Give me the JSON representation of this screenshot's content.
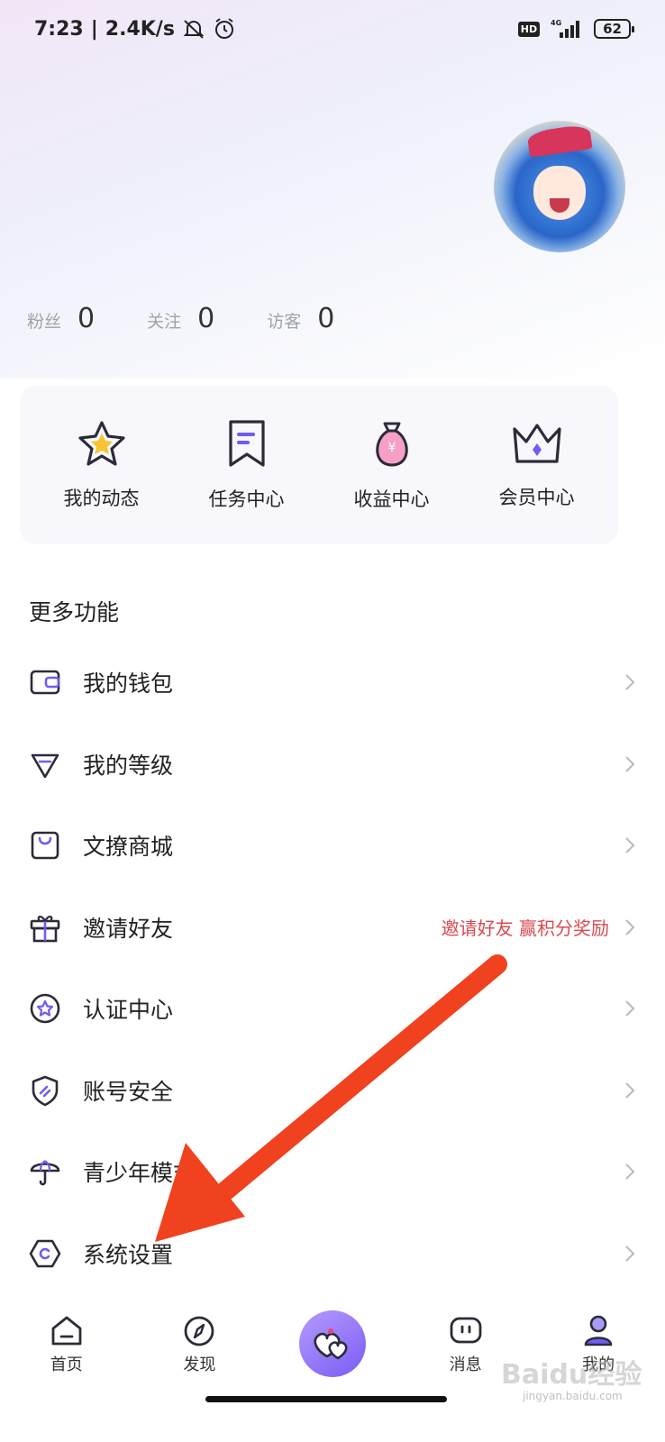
{
  "status_bar": {
    "time": "7:23",
    "speed": "2.4K/s",
    "network": "4G",
    "battery": "62"
  },
  "stats": [
    {
      "label": "粉丝",
      "value": "0"
    },
    {
      "label": "关注",
      "value": "0"
    },
    {
      "label": "访客",
      "value": "0"
    }
  ],
  "quick_actions": [
    {
      "label": "我的动态",
      "icon": "star-icon"
    },
    {
      "label": "任务中心",
      "icon": "bookmark-icon"
    },
    {
      "label": "收益中心",
      "icon": "money-bag-icon"
    },
    {
      "label": "会员中心",
      "icon": "crown-icon"
    }
  ],
  "section_title": "更多功能",
  "menu": [
    {
      "label": "我的钱包",
      "icon": "wallet-icon",
      "extra": ""
    },
    {
      "label": "我的等级",
      "icon": "diamond-icon",
      "extra": ""
    },
    {
      "label": "文撩商城",
      "icon": "shopping-bag-icon",
      "extra": ""
    },
    {
      "label": "邀请好友",
      "icon": "gift-icon",
      "extra": "邀请好友 赢积分奖励"
    },
    {
      "label": "认证中心",
      "icon": "badge-star-icon",
      "extra": ""
    },
    {
      "label": "账号安全",
      "icon": "shield-icon",
      "extra": ""
    },
    {
      "label": "青少年模式",
      "icon": "umbrella-icon",
      "extra": ""
    },
    {
      "label": "系统设置",
      "icon": "hexagon-settings-icon",
      "extra": ""
    }
  ],
  "tabs": [
    {
      "label": "首页",
      "icon": "home-icon"
    },
    {
      "label": "发现",
      "icon": "compass-icon"
    },
    {
      "label": "",
      "icon": "hearts-icon"
    },
    {
      "label": "消息",
      "icon": "message-icon"
    },
    {
      "label": "我的",
      "icon": "user-icon"
    }
  ],
  "watermark": "Baidu经验",
  "watermark_sub": "jingyan.baidu.com",
  "colors": {
    "accent": "#7a5cf2",
    "invite_text": "#d94a50",
    "arrow": "#f0421f"
  }
}
